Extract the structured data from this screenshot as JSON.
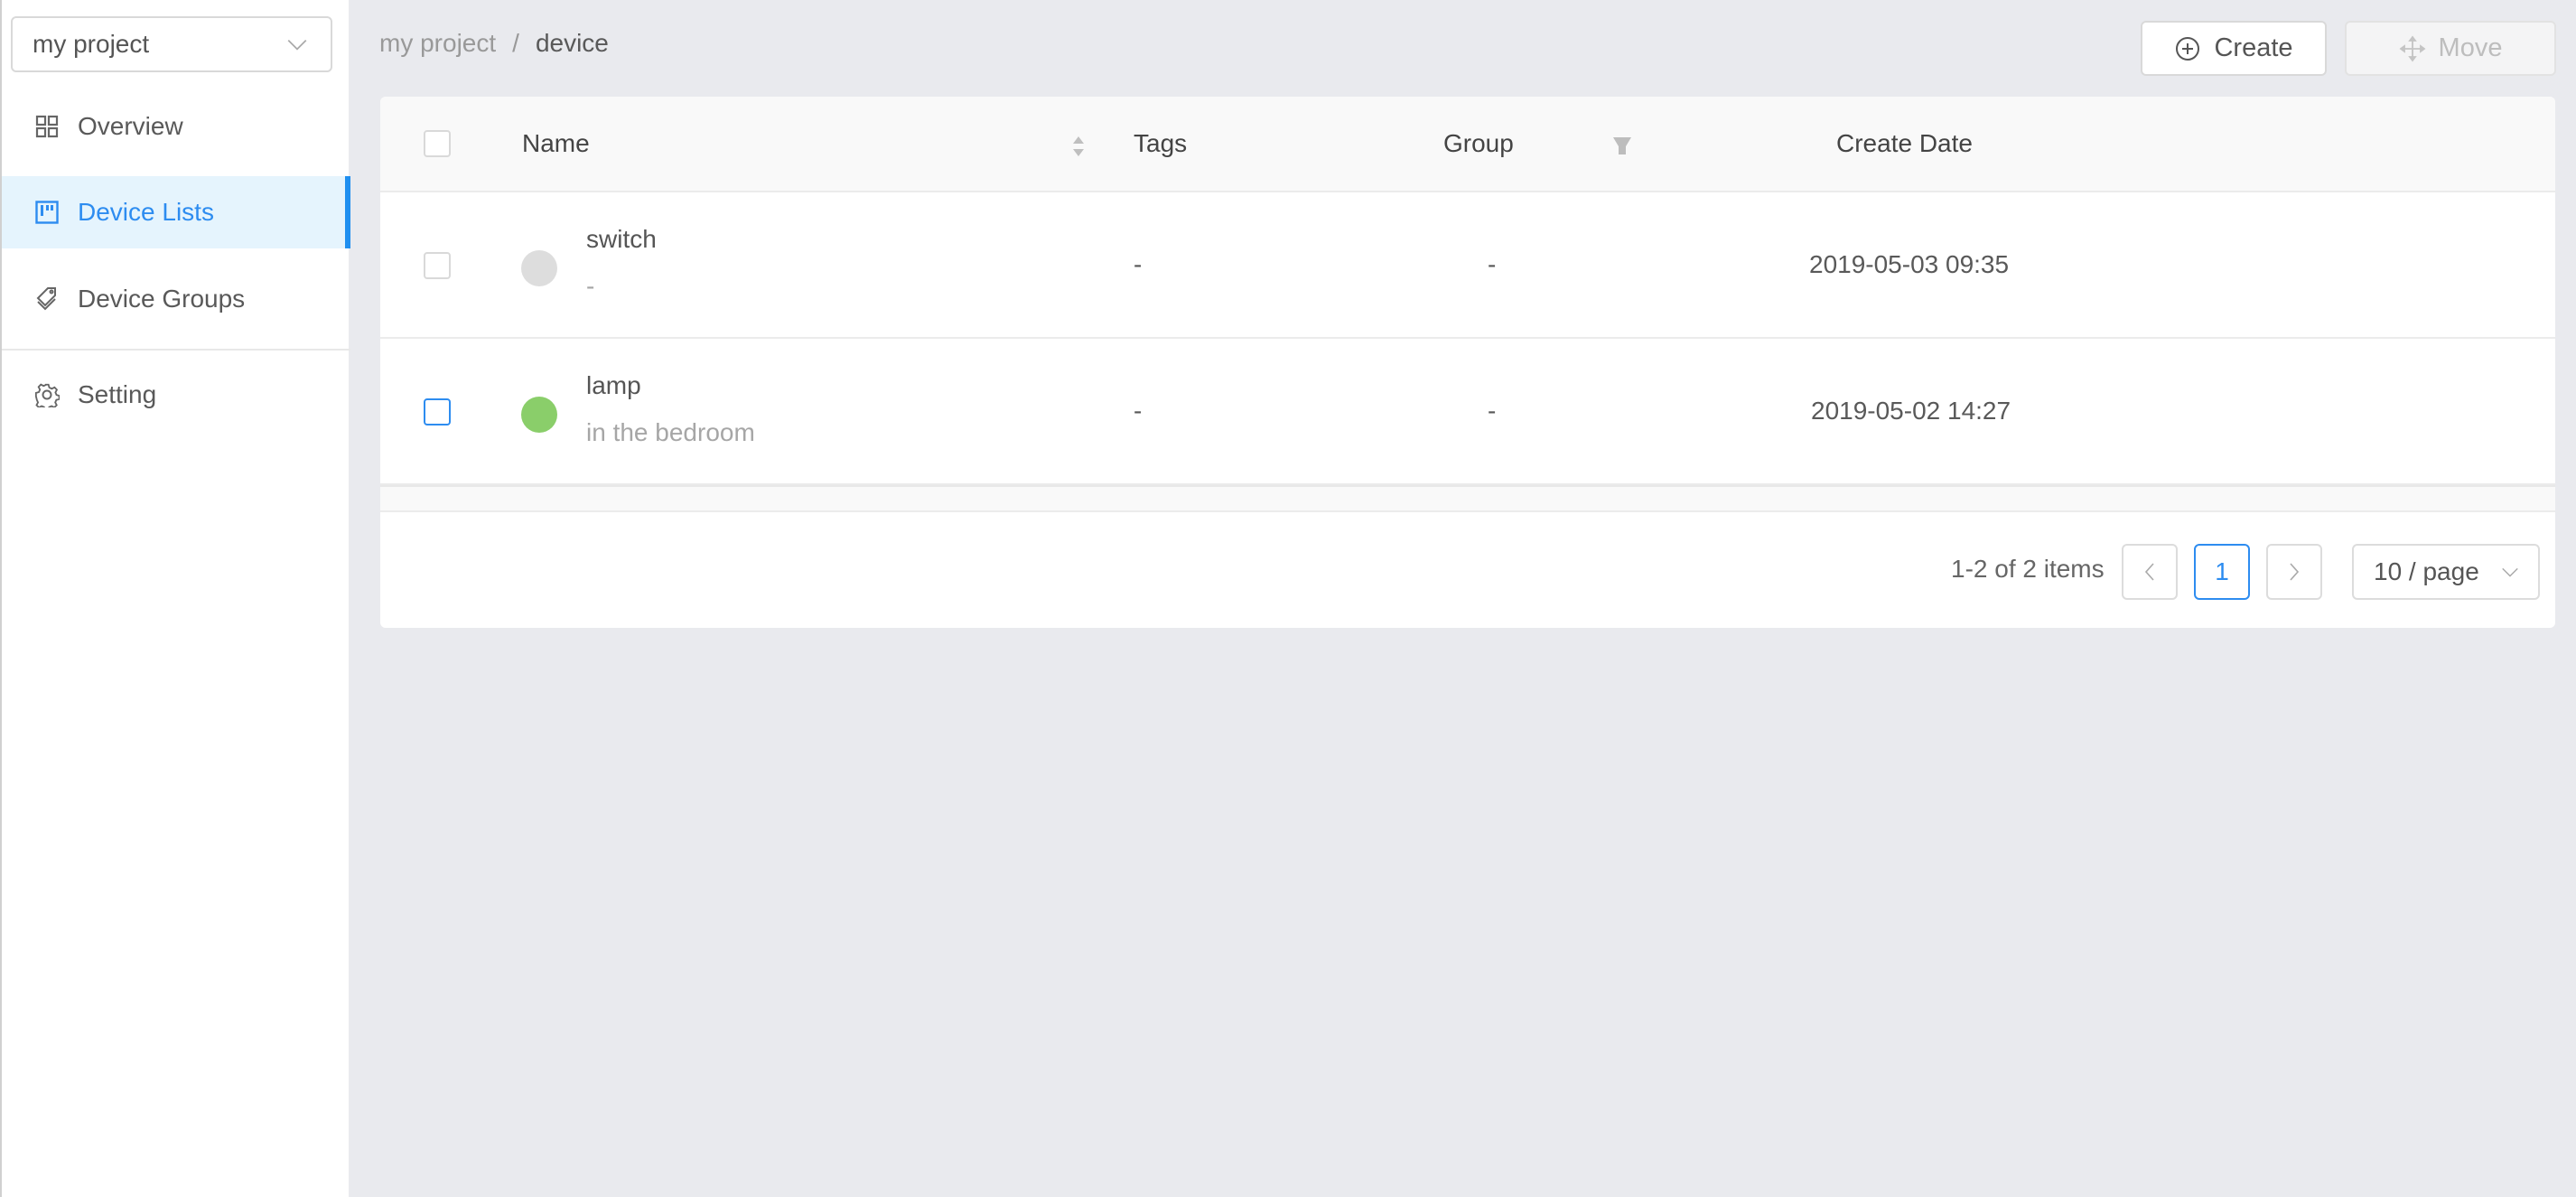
{
  "sidebar": {
    "project_select": {
      "value": "my project"
    },
    "items": [
      {
        "label": "Overview",
        "icon": "grid-icon",
        "active": false
      },
      {
        "label": "Device Lists",
        "icon": "board-icon",
        "active": true
      },
      {
        "label": "Device Groups",
        "icon": "tags-icon",
        "active": false
      },
      {
        "label": "Setting",
        "icon": "gear-icon",
        "active": false
      }
    ]
  },
  "breadcrumb": {
    "items": [
      "my project",
      "device"
    ],
    "separator": "/"
  },
  "toolbar": {
    "create_label": "Create",
    "move_label": "Move"
  },
  "table": {
    "columns": [
      "Name",
      "Tags",
      "Group",
      "Create Date"
    ],
    "rows": [
      {
        "name": "switch",
        "description": "-",
        "status": "offline",
        "status_color": "#dddddd",
        "tags": "-",
        "group": "-",
        "create_date": "2019-05-03 09:35"
      },
      {
        "name": "lamp",
        "description": "in the bedroom",
        "status": "online",
        "status_color": "#8ace6a",
        "tags": "-",
        "group": "-",
        "create_date": "2019-05-02 14:27"
      }
    ]
  },
  "pagination": {
    "total_text": "1-2 of 2 items",
    "current_page": "1",
    "page_size": "10 / page"
  },
  "colors": {
    "accent": "#2d8cf0",
    "background": "#e9eaee",
    "active_nav_bg": "#e5f4fd"
  }
}
